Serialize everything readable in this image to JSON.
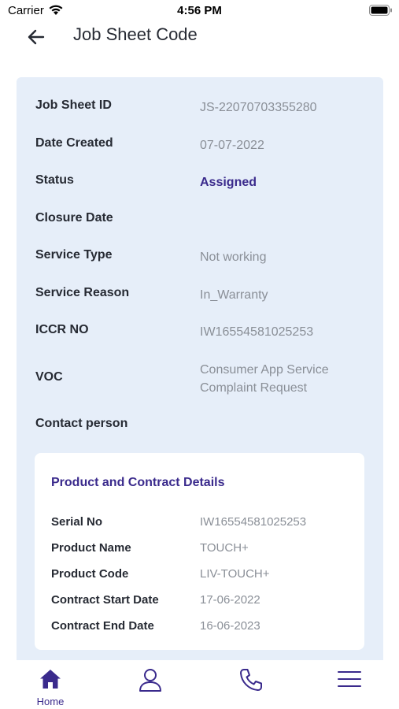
{
  "status_bar": {
    "carrier": "Carrier",
    "time": "4:56 PM"
  },
  "header": {
    "title": "Job Sheet Code",
    "back_icon": "arrow-left-icon"
  },
  "details": [
    {
      "label": "Job Sheet ID",
      "value": "JS-22070703355280"
    },
    {
      "label": "Date Created",
      "value": "07-07-2022"
    },
    {
      "label": "Status",
      "value": "Assigned"
    },
    {
      "label": "Closure Date",
      "value": ""
    },
    {
      "label": "Service Type",
      "value": "Not working"
    },
    {
      "label": "Service Reason",
      "value": "In_Warranty"
    },
    {
      "label": "ICCR NO",
      "value": "IW16554581025253"
    },
    {
      "label": "VOC",
      "value": "Consumer App Service Complaint Request"
    },
    {
      "label": "Contact person",
      "value": ""
    }
  ],
  "product_section": {
    "title": "Product and Contract Details",
    "rows": [
      {
        "label": "Serial No",
        "value": "IW16554581025253"
      },
      {
        "label": "Product Name",
        "value": "TOUCH+"
      },
      {
        "label": "Product Code",
        "value": "LIV-TOUCH+"
      },
      {
        "label": "Contract Start Date",
        "value": "17-06-2022"
      },
      {
        "label": "Contract End Date",
        "value": "16-06-2023"
      }
    ]
  },
  "tab_bar": {
    "items": [
      {
        "label": "Home",
        "icon": "home-icon",
        "active": true
      },
      {
        "label": "",
        "icon": "profile-icon",
        "active": false
      },
      {
        "label": "",
        "icon": "phone-icon",
        "active": false
      },
      {
        "label": "",
        "icon": "menu-icon",
        "active": false
      }
    ]
  },
  "colors": {
    "accent": "#3a2a8c",
    "card_background": "#e6eef9",
    "value_text": "#8a8f97"
  }
}
